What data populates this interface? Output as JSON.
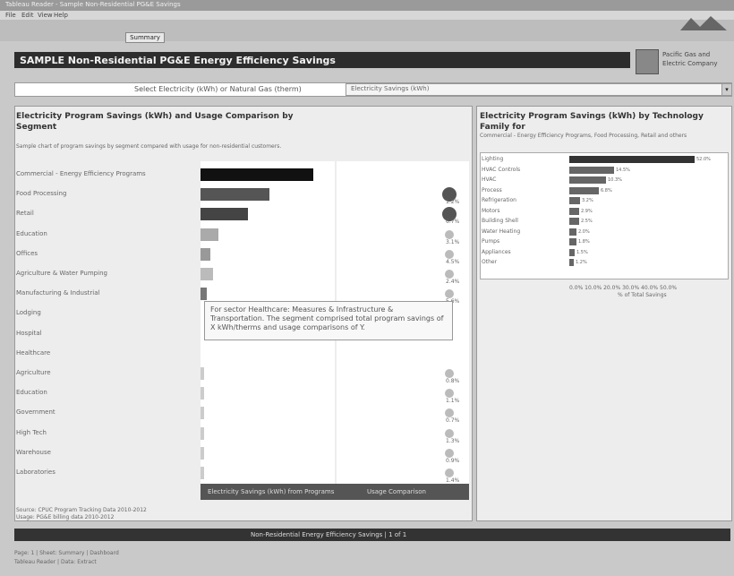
{
  "window": {
    "title": "Tableau Reader - Sample Non-Residential PG&E Savings",
    "menu": [
      "File",
      "Edit",
      "View",
      "Help"
    ],
    "tab": "Summary"
  },
  "header": {
    "title": "SAMPLE Non-Residential PG&E Energy Efficiency Savings",
    "org": "Pacific Gas and Electric Company"
  },
  "selector": {
    "label": "Select Electricity (kWh) or Natural Gas (therm)",
    "value": "Electricity Savings (kWh)"
  },
  "left": {
    "title": "Electricity Program Savings (kWh) and Usage Comparison by Segment",
    "description": "Sample chart of program savings by segment compared with usage for non-residential customers.",
    "rows": [
      {
        "label": "Commercial - Energy Efficiency Programs",
        "bar": 0.9,
        "color": "#111111",
        "value": "",
        "circle": ""
      },
      {
        "label": "Food Processing",
        "bar": 0.55,
        "color": "#555555",
        "value": "",
        "circle": "1.2%"
      },
      {
        "label": "Retail",
        "bar": 0.38,
        "color": "#444444",
        "value": "",
        "circle": "6.7%"
      },
      {
        "label": "Education",
        "bar": 0.14,
        "color": "#aaaaaa",
        "value": "",
        "circle": "3.1%"
      },
      {
        "label": "Offices",
        "bar": 0.08,
        "color": "#999999",
        "value": "",
        "circle": "4.5%"
      },
      {
        "label": "Agriculture & Water Pumping",
        "bar": 0.1,
        "color": "#bbbbbb",
        "value": "",
        "circle": "2.4%"
      },
      {
        "label": "Manufacturing & Industrial",
        "bar": 0.05,
        "color": "#777777",
        "value": "",
        "circle": "5.6%"
      },
      {
        "label": "Lodging",
        "bar": 0,
        "color": "#cccccc",
        "value": "",
        "circle": ""
      },
      {
        "label": "Hospital",
        "bar": 0,
        "color": "#cccccc",
        "value": "",
        "circle": ""
      },
      {
        "label": "Healthcare",
        "bar": 0,
        "color": "#cccccc",
        "value": "",
        "circle": ""
      },
      {
        "label": "Agriculture",
        "bar": 0.01,
        "color": "#cccccc",
        "value": "",
        "circle": "0.8%"
      },
      {
        "label": "Education",
        "bar": 0.01,
        "color": "#cccccc",
        "value": "",
        "circle": "1.1%"
      },
      {
        "label": "Government",
        "bar": 0.01,
        "color": "#cccccc",
        "value": "",
        "circle": "0.7%"
      },
      {
        "label": "High Tech",
        "bar": 0.01,
        "color": "#cccccc",
        "value": "",
        "circle": "1.3%"
      },
      {
        "label": "Warehouse",
        "bar": 0.01,
        "color": "#cccccc",
        "value": "",
        "circle": "0.9%"
      },
      {
        "label": "Laboratories",
        "bar": 0.01,
        "color": "#cccccc",
        "value": "",
        "circle": "1.4%"
      }
    ],
    "tooltip": "For sector Healthcare: Measures & Infrastructure & Transportation. The segment comprised total program savings of X kWh/therms and usage comparisons of Y.",
    "tab_left": "Electricity Savings (kWh) from Programs",
    "tab_right": "Usage Comparison",
    "source": "Source: CPUC Program Tracking Data 2010-2012\nUsage: PG&E billing data 2010-2012"
  },
  "right": {
    "title": "Electricity Program Savings (kWh) by Technology Family for",
    "subtitle": "Commercial - Energy Efficiency Programs, Food Processing, Retail and others",
    "rows": [
      {
        "label": "Lighting",
        "value": 0.93,
        "val_text": "52.0%"
      },
      {
        "label": "HVAC Controls",
        "value": 0.33,
        "val_text": "14.5%"
      },
      {
        "label": "HVAC",
        "value": 0.27,
        "val_text": "10.3%"
      },
      {
        "label": "Process",
        "value": 0.22,
        "val_text": "6.8%"
      },
      {
        "label": "Refrigeration",
        "value": 0.08,
        "val_text": "3.2%"
      },
      {
        "label": "Motors",
        "value": 0.07,
        "val_text": "2.9%"
      },
      {
        "label": "Building Shell",
        "value": 0.07,
        "val_text": "2.5%"
      },
      {
        "label": "Water Heating",
        "value": 0.05,
        "val_text": "2.0%"
      },
      {
        "label": "Pumps",
        "value": 0.05,
        "val_text": "1.8%"
      },
      {
        "label": "Appliances",
        "value": 0.04,
        "val_text": "1.5%"
      },
      {
        "label": "Other",
        "value": 0.03,
        "val_text": "1.2%"
      }
    ],
    "axis": "0.0%   10.0%   20.0%   30.0%   40.0%   50.0%",
    "axis_title": "% of Total Savings"
  },
  "bottom": {
    "bar": "Non-Residential Energy Efficiency Savings | 1 of 1",
    "status1": "Page: 1 | Sheet: Summary | Dashboard",
    "status2": "Tableau Reader | Data: Extract"
  }
}
